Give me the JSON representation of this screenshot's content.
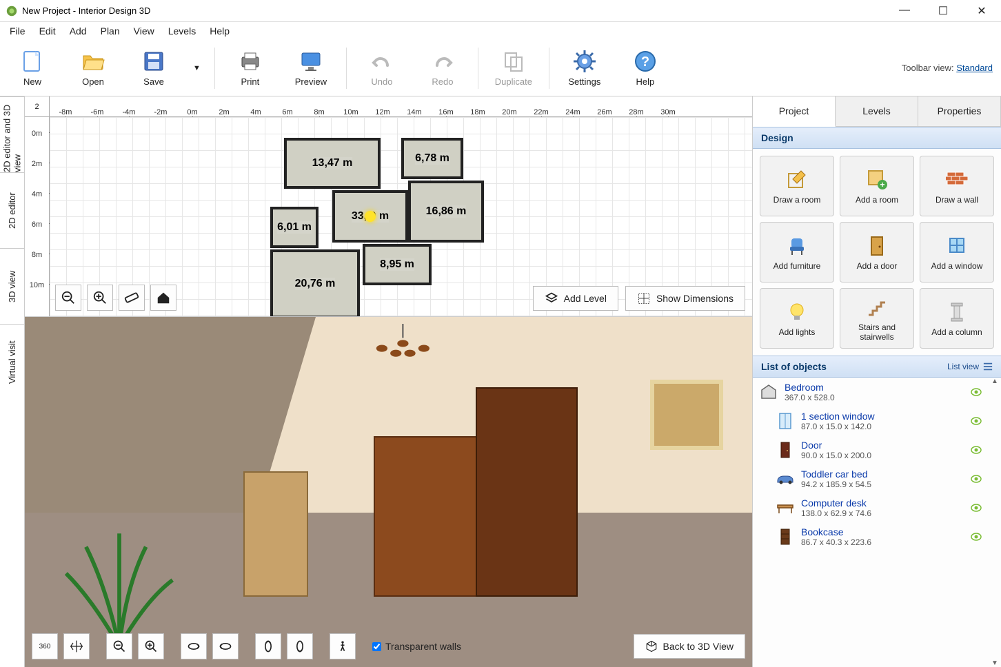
{
  "window": {
    "title": "New Project - Interior Design 3D",
    "minimize": "—",
    "maximize": "☐",
    "close": "✕"
  },
  "menus": [
    "File",
    "Edit",
    "Add",
    "Plan",
    "View",
    "Levels",
    "Help"
  ],
  "toolbar": {
    "new": "New",
    "open": "Open",
    "save": "Save",
    "print": "Print",
    "preview": "Preview",
    "undo": "Undo",
    "redo": "Redo",
    "duplicate": "Duplicate",
    "settings": "Settings",
    "help": "Help",
    "view_label": "Toolbar view:",
    "view_value": "Standard"
  },
  "left_tabs": {
    "combo": "2D editor and 3D view",
    "editor2d": "2D editor",
    "view3d": "3D view",
    "virtual": "Virtual visit"
  },
  "ruler": {
    "corner": "2",
    "h": [
      "-8m",
      "-6m",
      "-4m",
      "-2m",
      "0m",
      "2m",
      "4m",
      "6m",
      "8m",
      "10m",
      "12m",
      "14m",
      "16m",
      "18m",
      "20m",
      "22m",
      "24m",
      "26m",
      "28m",
      "30m"
    ],
    "v": [
      "0m",
      "2m",
      "4m",
      "6m",
      "8m",
      "10m"
    ]
  },
  "floorplan_labels": {
    "r1": "13,47 m",
    "r2": "6,78 m",
    "r3": "33,.9 m",
    "r4": "16,86 m",
    "r5": "6,01 m",
    "r6": "20,76 m",
    "r7": "8,95 m"
  },
  "view2d_buttons": {
    "add_level": "Add Level",
    "show_dims": "Show Dimensions"
  },
  "view3d_buttons": {
    "transparent_walls": "Transparent walls",
    "back_to_3d": "Back to 3D View"
  },
  "right_tabs": {
    "project": "Project",
    "levels": "Levels",
    "properties": "Properties"
  },
  "sections": {
    "design": "Design",
    "objects": "List of objects",
    "list_view": "List view"
  },
  "design_buttons": {
    "draw_room": "Draw a room",
    "add_room": "Add a room",
    "draw_wall": "Draw a wall",
    "add_furniture": "Add furniture",
    "add_door": "Add a door",
    "add_window": "Add a window",
    "add_lights": "Add lights",
    "stairs": "Stairs and stairwells",
    "add_column": "Add a column"
  },
  "objects": [
    {
      "name": "Bedroom",
      "dims": "367.0 x 528.0",
      "indent": 0,
      "icon": "room"
    },
    {
      "name": "1 section window",
      "dims": "87.0 x 15.0 x 142.0",
      "indent": 1,
      "icon": "window"
    },
    {
      "name": "Door",
      "dims": "90.0 x 15.0 x 200.0",
      "indent": 1,
      "icon": "door"
    },
    {
      "name": "Toddler car bed",
      "dims": "94.2 x 185.9 x 54.5",
      "indent": 1,
      "icon": "car"
    },
    {
      "name": "Computer desk",
      "dims": "138.0 x 62.9 x 74.6",
      "indent": 1,
      "icon": "desk"
    },
    {
      "name": "Bookcase",
      "dims": "86.7 x 40.3 x 223.6",
      "indent": 1,
      "icon": "bookcase"
    }
  ]
}
